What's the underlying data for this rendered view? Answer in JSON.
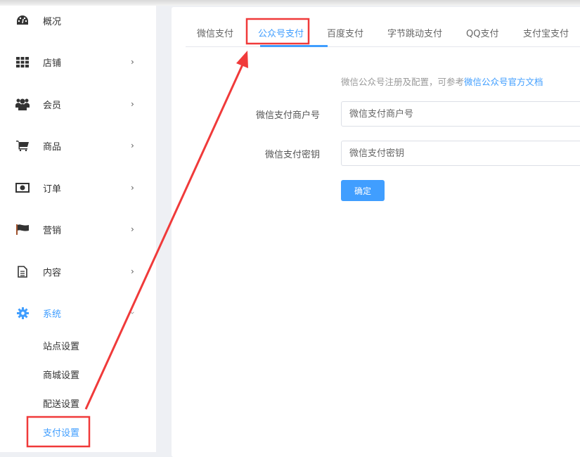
{
  "sidebar": {
    "items": [
      {
        "label": "概况",
        "icon": "dashboard-icon"
      },
      {
        "label": "店铺",
        "icon": "grid-icon"
      },
      {
        "label": "会员",
        "icon": "users-icon"
      },
      {
        "label": "商品",
        "icon": "cart-icon"
      },
      {
        "label": "订单",
        "icon": "money-icon"
      },
      {
        "label": "营销",
        "icon": "flag-icon"
      },
      {
        "label": "内容",
        "icon": "document-icon"
      },
      {
        "label": "系统",
        "icon": "gear-icon"
      }
    ],
    "submenu": [
      "站点设置",
      "商城设置",
      "配送设置",
      "支付设置"
    ]
  },
  "tabs": [
    "微信支付",
    "公众号支付",
    "百度支付",
    "字节跳动支付",
    "QQ支付",
    "支付宝支付"
  ],
  "form": {
    "hint": "微信公众号注册及配置，可参考",
    "hint_link": "微信公众号官方文档",
    "merchant_label": "微信支付商户号",
    "merchant_placeholder": "微信支付商户号",
    "key_label": "微信支付密钥",
    "key_placeholder": "微信支付密钥",
    "submit": "确定"
  },
  "colors": {
    "accent": "#409eff",
    "annotation": "#f03a3a"
  }
}
